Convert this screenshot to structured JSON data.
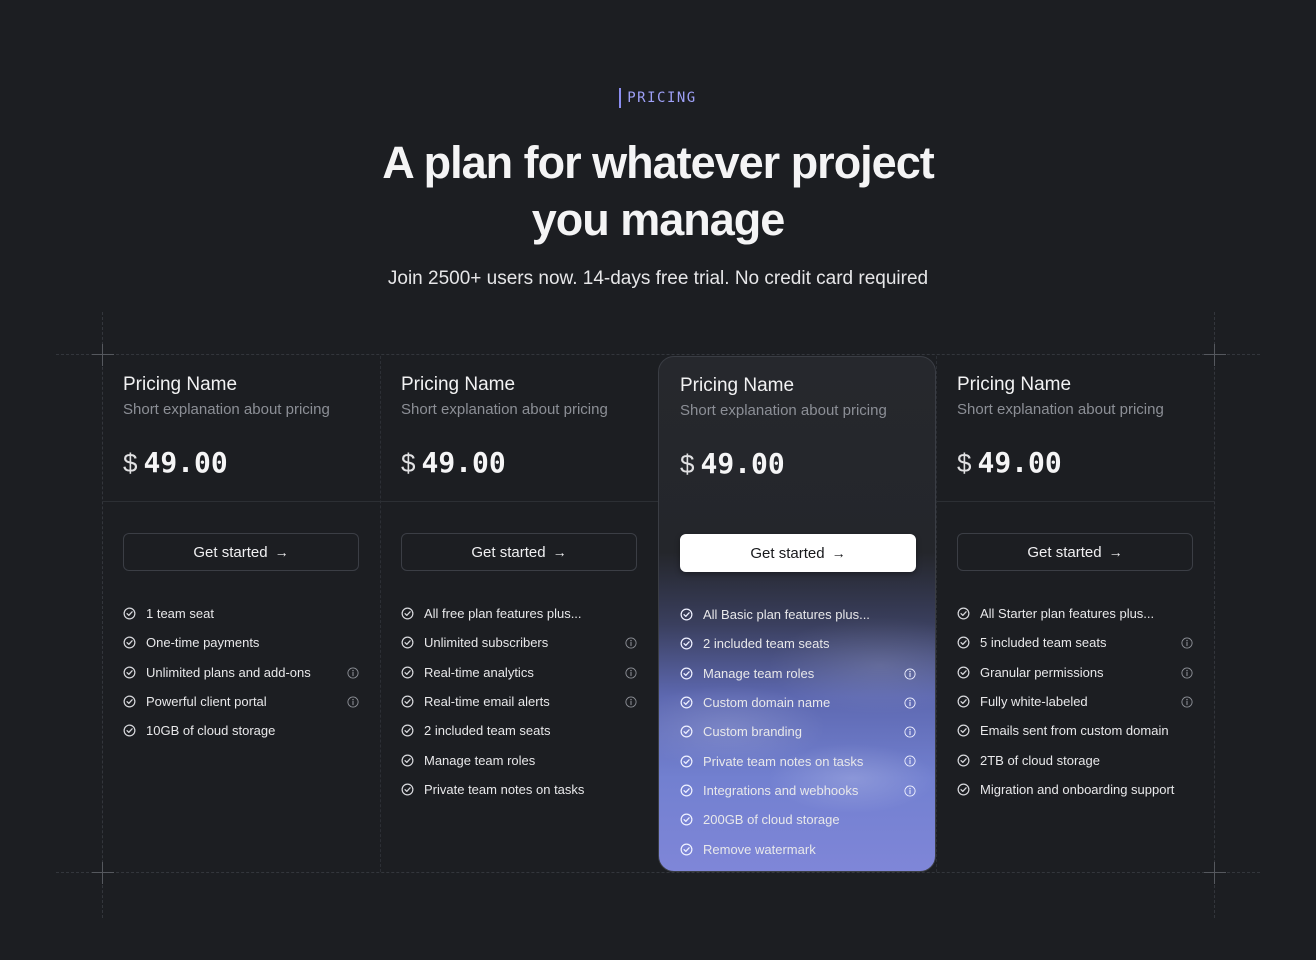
{
  "eyebrow": "PRICING",
  "headline": {
    "line1": "A plan for whatever project",
    "line2": "you manage"
  },
  "subline": "Join 2500+ users now. 14-days free trial. No credit card required",
  "icons": {
    "check": "check-circle-icon",
    "info": "info-icon",
    "arrow": "arrow-right-icon"
  },
  "colors": {
    "background": "#1c1e22",
    "accent": "#9ea0f7",
    "featured_gradient_end": "#7f86d8"
  },
  "plans": [
    {
      "name": "Pricing Name",
      "description": "Short explanation about pricing",
      "currency": "$",
      "price": "49.00",
      "cta": "Get started",
      "arrow": "→",
      "featured": false,
      "features": [
        {
          "text": "1 team seat",
          "info": false
        },
        {
          "text": "One-time payments",
          "info": false
        },
        {
          "text": "Unlimited plans and add-ons",
          "info": true
        },
        {
          "text": "Powerful client portal",
          "info": true
        },
        {
          "text": "10GB of cloud storage",
          "info": false
        }
      ]
    },
    {
      "name": "Pricing Name",
      "description": "Short explanation about pricing",
      "currency": "$",
      "price": "49.00",
      "cta": "Get started",
      "arrow": "→",
      "featured": false,
      "features": [
        {
          "text": "All free plan features plus...",
          "info": false
        },
        {
          "text": "Unlimited subscribers",
          "info": true
        },
        {
          "text": "Real-time analytics",
          "info": true
        },
        {
          "text": "Real-time email alerts",
          "info": true
        },
        {
          "text": "2 included team seats",
          "info": false
        },
        {
          "text": "Manage team roles",
          "info": false
        },
        {
          "text": "Private team notes on tasks",
          "info": false
        }
      ]
    },
    {
      "name": "Pricing Name",
      "description": "Short explanation about pricing",
      "currency": "$",
      "price": "49.00",
      "cta": "Get started",
      "arrow": "→",
      "featured": true,
      "features": [
        {
          "text": "All Basic plan features plus...",
          "info": false
        },
        {
          "text": "2 included team seats",
          "info": false
        },
        {
          "text": "Manage team roles",
          "info": true
        },
        {
          "text": "Custom domain name",
          "info": true
        },
        {
          "text": "Custom branding",
          "info": true
        },
        {
          "text": "Private team notes on tasks",
          "info": true
        },
        {
          "text": "Integrations and webhooks",
          "info": true
        },
        {
          "text": "200GB of cloud storage",
          "info": false
        },
        {
          "text": "Remove watermark",
          "info": false
        }
      ]
    },
    {
      "name": "Pricing Name",
      "description": "Short explanation about pricing",
      "currency": "$",
      "price": "49.00",
      "cta": "Get started",
      "arrow": "→",
      "featured": false,
      "features": [
        {
          "text": "All Starter plan features plus...",
          "info": false
        },
        {
          "text": "5 included team seats",
          "info": true
        },
        {
          "text": "Granular permissions",
          "info": true
        },
        {
          "text": "Fully white-labeled",
          "info": true
        },
        {
          "text": "Emails sent from custom domain",
          "info": false
        },
        {
          "text": "2TB of cloud storage",
          "info": false
        },
        {
          "text": "Migration and onboarding support",
          "info": false
        }
      ]
    }
  ]
}
